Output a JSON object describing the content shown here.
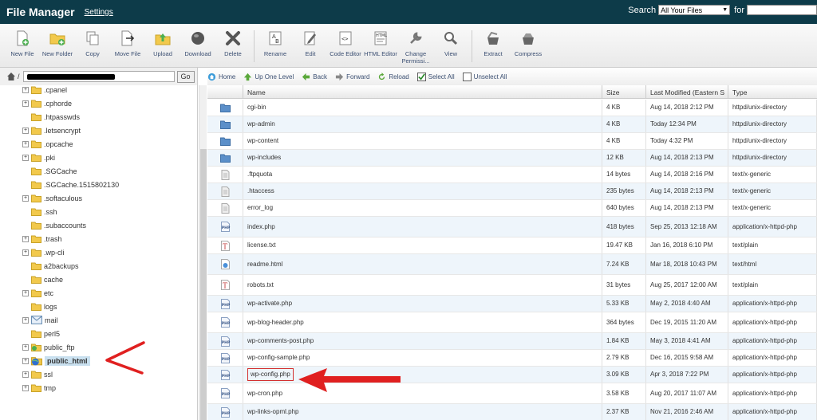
{
  "header": {
    "title": "File Manager",
    "settings": "Settings",
    "search_label": "Search",
    "search_scope": "All Your Files",
    "for_label": "for"
  },
  "toolbar": [
    {
      "id": "new-file",
      "label": "New File"
    },
    {
      "id": "new-folder",
      "label": "New Folder"
    },
    {
      "id": "copy",
      "label": "Copy"
    },
    {
      "id": "move-file",
      "label": "Move File"
    },
    {
      "id": "upload",
      "label": "Upload"
    },
    {
      "id": "download",
      "label": "Download"
    },
    {
      "id": "delete",
      "label": "Delete"
    },
    {
      "id": "rename",
      "label": "Rename"
    },
    {
      "id": "edit",
      "label": "Edit"
    },
    {
      "id": "code-editor",
      "label": "Code Editor"
    },
    {
      "id": "html-editor",
      "label": "HTML Editor"
    },
    {
      "id": "change-permissions",
      "label": "Change Permissi..."
    },
    {
      "id": "view",
      "label": "View"
    },
    {
      "id": "extract",
      "label": "Extract"
    },
    {
      "id": "compress",
      "label": "Compress"
    }
  ],
  "address": {
    "path_prefix": "/",
    "go": "Go"
  },
  "nav": {
    "home": "Home",
    "up": "Up One Level",
    "back": "Back",
    "forward": "Forward",
    "reload": "Reload",
    "select_all": "Select All",
    "unselect_all": "Unselect All"
  },
  "tree": [
    {
      "label": ".cpanel",
      "exp": true,
      "icon": "folder"
    },
    {
      "label": ".cphorde",
      "exp": true,
      "icon": "folder"
    },
    {
      "label": ".htpasswds",
      "exp": false,
      "icon": "folder"
    },
    {
      "label": ".letsencrypt",
      "exp": true,
      "icon": "folder"
    },
    {
      "label": ".opcache",
      "exp": true,
      "icon": "folder"
    },
    {
      "label": ".pki",
      "exp": true,
      "icon": "folder"
    },
    {
      "label": ".SGCache",
      "exp": false,
      "icon": "folder"
    },
    {
      "label": ".SGCache.1515802130",
      "exp": false,
      "icon": "folder"
    },
    {
      "label": ".softaculous",
      "exp": true,
      "icon": "folder"
    },
    {
      "label": ".ssh",
      "exp": false,
      "icon": "folder"
    },
    {
      "label": ".subaccounts",
      "exp": false,
      "icon": "folder"
    },
    {
      "label": ".trash",
      "exp": true,
      "icon": "folder"
    },
    {
      "label": ".wp-cli",
      "exp": true,
      "icon": "folder"
    },
    {
      "label": "a2backups",
      "exp": false,
      "icon": "folder"
    },
    {
      "label": "cache",
      "exp": false,
      "icon": "folder"
    },
    {
      "label": "etc",
      "exp": true,
      "icon": "folder"
    },
    {
      "label": "logs",
      "exp": false,
      "icon": "folder"
    },
    {
      "label": "mail",
      "exp": true,
      "icon": "mail"
    },
    {
      "label": "perl5",
      "exp": false,
      "icon": "folder"
    },
    {
      "label": "public_ftp",
      "exp": true,
      "icon": "ftp"
    },
    {
      "label": "public_html",
      "exp": true,
      "icon": "globe",
      "selected": true
    },
    {
      "label": "ssl",
      "exp": true,
      "icon": "folder"
    },
    {
      "label": "tmp",
      "exp": true,
      "icon": "folder"
    }
  ],
  "columns": {
    "name": "Name",
    "size": "Size",
    "modified": "Last Modified (Eastern S",
    "type": "Type"
  },
  "files": [
    {
      "name": "cgi-bin",
      "size": "4 KB",
      "modified": "Aug 14, 2018 2:12 PM",
      "type": "httpd/unix-directory",
      "icon": "folder"
    },
    {
      "name": "wp-admin",
      "size": "4 KB",
      "modified": "Today 12:34 PM",
      "type": "httpd/unix-directory",
      "icon": "folder"
    },
    {
      "name": "wp-content",
      "size": "4 KB",
      "modified": "Today 4:32 PM",
      "type": "httpd/unix-directory",
      "icon": "folder"
    },
    {
      "name": "wp-includes",
      "size": "12 KB",
      "modified": "Aug 14, 2018 2:13 PM",
      "type": "httpd/unix-directory",
      "icon": "folder"
    },
    {
      "name": ".ftpquota",
      "size": "14 bytes",
      "modified": "Aug 14, 2018 2:16 PM",
      "type": "text/x-generic",
      "icon": "generic"
    },
    {
      "name": ".htaccess",
      "size": "235 bytes",
      "modified": "Aug 14, 2018 2:13 PM",
      "type": "text/x-generic",
      "icon": "generic"
    },
    {
      "name": "error_log",
      "size": "640 bytes",
      "modified": "Aug 14, 2018 2:13 PM",
      "type": "text/x-generic",
      "icon": "generic"
    },
    {
      "name": "index.php",
      "size": "418 bytes",
      "modified": "Sep 25, 2013 12:18 AM",
      "type": "application/x-httpd-php",
      "icon": "php"
    },
    {
      "name": "license.txt",
      "size": "19.47 KB",
      "modified": "Jan 16, 2018 6:10 PM",
      "type": "text/plain",
      "icon": "text"
    },
    {
      "name": "readme.html",
      "size": "7.24 KB",
      "modified": "Mar 18, 2018 10:43 PM",
      "type": "text/html",
      "icon": "html"
    },
    {
      "name": "robots.txt",
      "size": "31 bytes",
      "modified": "Aug 25, 2017 12:00 AM",
      "type": "text/plain",
      "icon": "text"
    },
    {
      "name": "wp-activate.php",
      "size": "5.33 KB",
      "modified": "May 2, 2018 4:40 AM",
      "type": "application/x-httpd-php",
      "icon": "php"
    },
    {
      "name": "wp-blog-header.php",
      "size": "364 bytes",
      "modified": "Dec 19, 2015 11:20 AM",
      "type": "application/x-httpd-php",
      "icon": "php"
    },
    {
      "name": "wp-comments-post.php",
      "size": "1.84 KB",
      "modified": "May 3, 2018 4:41 AM",
      "type": "application/x-httpd-php",
      "icon": "php"
    },
    {
      "name": "wp-config-sample.php",
      "size": "2.79 KB",
      "modified": "Dec 16, 2015 9:58 AM",
      "type": "application/x-httpd-php",
      "icon": "php"
    },
    {
      "name": "wp-config.php",
      "size": "3.09 KB",
      "modified": "Apr 3, 2018 7:22 PM",
      "type": "application/x-httpd-php",
      "icon": "php",
      "highlight": true
    },
    {
      "name": "wp-cron.php",
      "size": "3.58 KB",
      "modified": "Aug 20, 2017 11:07 AM",
      "type": "application/x-httpd-php",
      "icon": "php"
    },
    {
      "name": "wp-links-opml.php",
      "size": "2.37 KB",
      "modified": "Nov 21, 2016 2:46 AM",
      "type": "application/x-httpd-php",
      "icon": "php"
    }
  ],
  "colors": {
    "header_bg": "#0d3b49",
    "row_alt": "#eef5fb",
    "annotation_red": "#e02020",
    "selected_bg": "#c9e0ef"
  }
}
